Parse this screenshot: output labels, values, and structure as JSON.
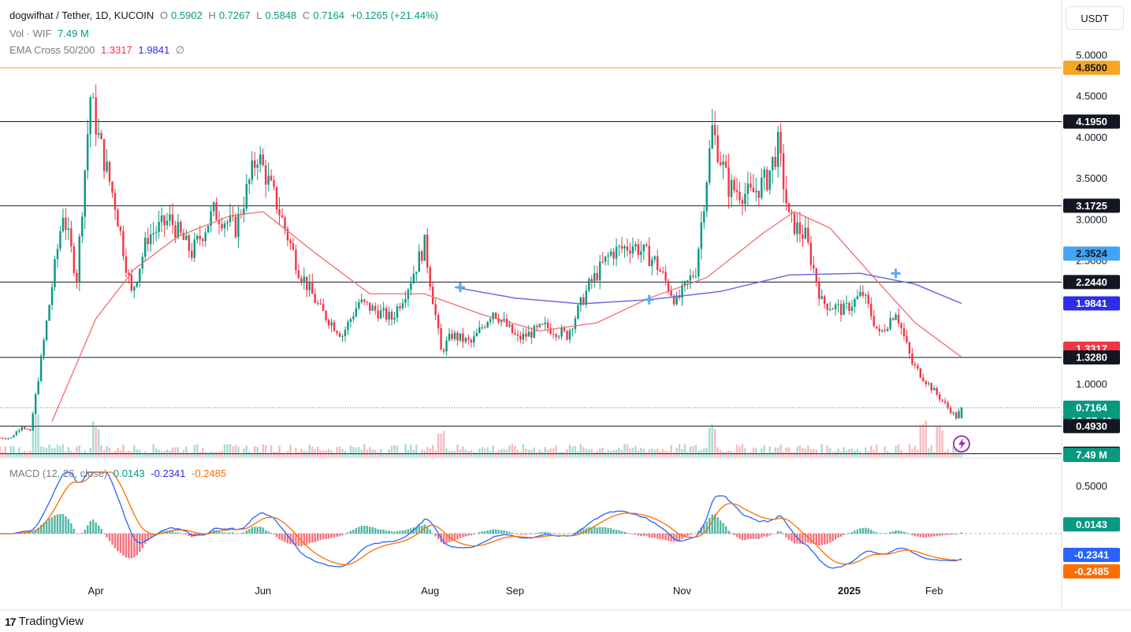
{
  "header": {
    "symbol": "dogwifhat / Tether, 1D, KUCOIN",
    "o_label": "O",
    "o_value": "0.5902",
    "h_label": "H",
    "h_value": "0.7267",
    "l_label": "L",
    "l_value": "0.5848",
    "c_label": "C",
    "c_value": "0.7164",
    "change": "+0.1265 (+21.44%)",
    "vol_label": "Vol · WIF",
    "vol_value": "7.49 M",
    "ema_label": "EMA Cross 50/200",
    "ema50_value": "1.3317",
    "ema200_value": "1.9841",
    "ema_symbol": "∅"
  },
  "unit_button": "USDT",
  "macd_legend": {
    "label": "MACD (12, 26, close)",
    "hist_value": "0.0143",
    "macd_value": "-0.2341",
    "signal_value": "-0.2485"
  },
  "footer": {
    "brand": "TradingView",
    "logo": "17"
  },
  "colors": {
    "up": "#089981",
    "down": "#f23645",
    "ema50": "#f26b6b",
    "ema200": "#6a6ce0",
    "macd": "#2962ff",
    "signal": "#ff6d00",
    "hline": "#131722",
    "orange_line": "#f5a623"
  },
  "chart_data": {
    "type": "candlestick",
    "symbol": "dogwifhat / Tether",
    "timeframe": "1D",
    "exchange": "KUCOIN",
    "x_ticks": [
      "Apr",
      "Jun",
      "Aug",
      "Sep",
      "Nov",
      "2025",
      "Feb"
    ],
    "y_ticks": [
      "1.0000",
      "2.5000",
      "3.0000",
      "3.5000",
      "4.0000",
      "4.5000",
      "5.0000"
    ],
    "price_labels": [
      {
        "value": "4.8500",
        "kind": "level-orange"
      },
      {
        "value": "4.1950",
        "kind": "level"
      },
      {
        "value": "3.1725",
        "kind": "level"
      },
      {
        "value": "2.3524",
        "kind": "crossover"
      },
      {
        "value": "2.2440",
        "kind": "level"
      },
      {
        "value": "1.9841",
        "kind": "ema200"
      },
      {
        "value": "1.3317",
        "kind": "ema50"
      },
      {
        "value": "1.3280",
        "kind": "level"
      },
      {
        "value": "0.7164",
        "kind": "last"
      },
      {
        "value": "12:57:42",
        "kind": "countdown"
      },
      {
        "value": "0.4930",
        "kind": "level"
      },
      {
        "value": "0.1565",
        "kind": "level"
      },
      {
        "value": "7.49 M",
        "kind": "volume"
      }
    ],
    "horizontal_levels": [
      4.85,
      4.195,
      3.1725,
      2.244,
      1.328,
      0.493,
      0.1565
    ],
    "price_path": [
      [
        "2024-03-01",
        0.35
      ],
      [
        "2024-03-05",
        0.5
      ],
      [
        "2024-03-08",
        0.42
      ],
      [
        "2024-03-12",
        1.3
      ],
      [
        "2024-03-16",
        2.2
      ],
      [
        "2024-03-20",
        3.1
      ],
      [
        "2024-03-25",
        2.3
      ],
      [
        "2024-03-30",
        4.5
      ],
      [
        "2024-04-02",
        4.0
      ],
      [
        "2024-04-08",
        3.2
      ],
      [
        "2024-04-14",
        2.1
      ],
      [
        "2024-04-20",
        2.8
      ],
      [
        "2024-04-28",
        3.0
      ],
      [
        "2024-05-06",
        2.6
      ],
      [
        "2024-05-14",
        3.1
      ],
      [
        "2024-05-22",
        2.9
      ],
      [
        "2024-05-30",
        3.8
      ],
      [
        "2024-06-06",
        3.2
      ],
      [
        "2024-06-14",
        2.4
      ],
      [
        "2024-06-22",
        1.9
      ],
      [
        "2024-06-30",
        1.6
      ],
      [
        "2024-07-06",
        2.0
      ],
      [
        "2024-07-12",
        1.9
      ],
      [
        "2024-07-18",
        1.8
      ],
      [
        "2024-07-24",
        2.2
      ],
      [
        "2024-07-30",
        2.7
      ],
      [
        "2024-08-05",
        1.4
      ],
      [
        "2024-08-09",
        1.6
      ],
      [
        "2024-08-16",
        1.5
      ],
      [
        "2024-08-24",
        1.9
      ],
      [
        "2024-09-02",
        1.55
      ],
      [
        "2024-09-12",
        1.7
      ],
      [
        "2024-09-20",
        1.6
      ],
      [
        "2024-09-28",
        2.2
      ],
      [
        "2024-10-06",
        2.6
      ],
      [
        "2024-10-14",
        2.7
      ],
      [
        "2024-10-22",
        2.5
      ],
      [
        "2024-10-30",
        2.0
      ],
      [
        "2024-11-06",
        2.4
      ],
      [
        "2024-11-12",
        4.1
      ],
      [
        "2024-11-18",
        3.4
      ],
      [
        "2024-11-26",
        3.3
      ],
      [
        "2024-12-02",
        3.5
      ],
      [
        "2024-12-06",
        3.9
      ],
      [
        "2024-12-10",
        3.0
      ],
      [
        "2024-12-16",
        2.8
      ],
      [
        "2024-12-22",
        2.0
      ],
      [
        "2024-12-30",
        1.9
      ],
      [
        "2025-01-06",
        2.1
      ],
      [
        "2025-01-12",
        1.6
      ],
      [
        "2025-01-18",
        1.9
      ],
      [
        "2025-01-24",
        1.25
      ],
      [
        "2025-01-30",
        1.0
      ],
      [
        "2025-02-04",
        0.8
      ],
      [
        "2025-02-09",
        0.6
      ],
      [
        "2025-02-11",
        0.7164
      ]
    ],
    "ema50_path": [
      [
        "2024-03-16",
        0.55
      ],
      [
        "2024-04-01",
        1.8
      ],
      [
        "2024-04-15",
        2.4
      ],
      [
        "2024-05-01",
        2.8
      ],
      [
        "2024-05-20",
        3.05
      ],
      [
        "2024-06-01",
        3.1
      ],
      [
        "2024-06-20",
        2.6
      ],
      [
        "2024-07-10",
        2.1
      ],
      [
        "2024-07-30",
        2.1
      ],
      [
        "2024-08-20",
        1.85
      ],
      [
        "2024-09-10",
        1.65
      ],
      [
        "2024-10-01",
        1.75
      ],
      [
        "2024-10-20",
        2.05
      ],
      [
        "2024-11-10",
        2.3
      ],
      [
        "2024-12-01",
        2.85
      ],
      [
        "2024-12-12",
        3.1
      ],
      [
        "2024-12-25",
        2.9
      ],
      [
        "2025-01-10",
        2.3
      ],
      [
        "2025-01-25",
        1.75
      ],
      [
        "2025-02-11",
        1.3317
      ]
    ],
    "ema200_path": [
      [
        "2024-08-10",
        2.18
      ],
      [
        "2024-09-01",
        2.05
      ],
      [
        "2024-09-25",
        1.98
      ],
      [
        "2024-10-20",
        2.03
      ],
      [
        "2024-11-15",
        2.13
      ],
      [
        "2024-12-10",
        2.33
      ],
      [
        "2025-01-05",
        2.35
      ],
      [
        "2025-01-25",
        2.22
      ],
      [
        "2025-02-11",
        1.9841
      ]
    ],
    "volume_spikes": [
      [
        "2024-03-10",
        7
      ],
      [
        "2024-04-01",
        5
      ],
      [
        "2024-08-05",
        4
      ],
      [
        "2024-11-12",
        5
      ],
      [
        "2025-01-28",
        5
      ],
      [
        "2025-02-03",
        4
      ]
    ],
    "macd": {
      "params": "12, 26, close",
      "y_ticks": [
        "0.5000"
      ],
      "histogram": "0.0143",
      "macd_line": "-0.2341",
      "signal_line": "-0.2485"
    }
  }
}
